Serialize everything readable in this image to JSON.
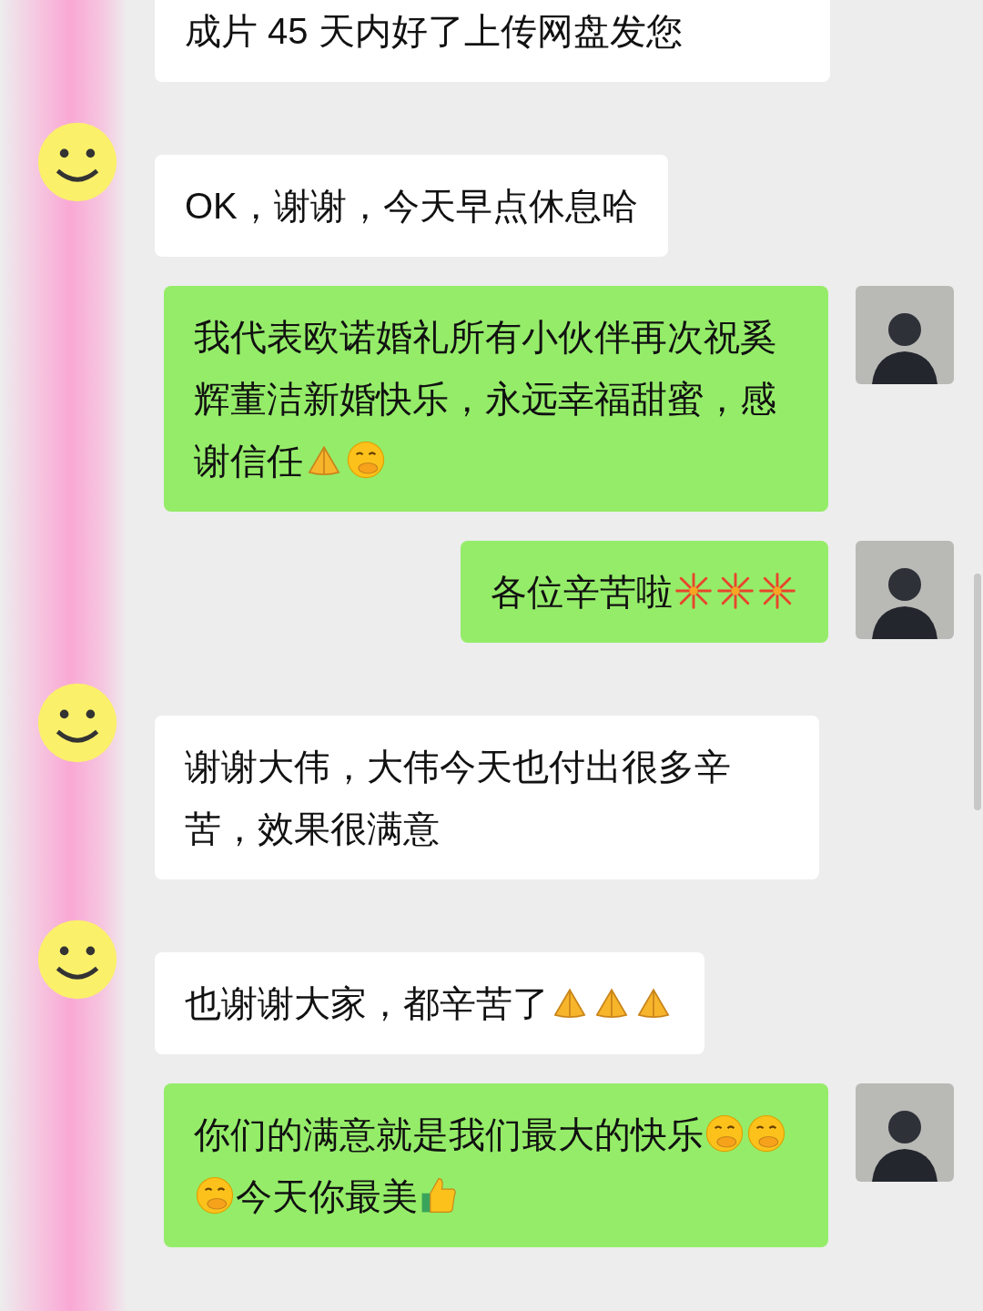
{
  "messages": [
    {
      "kind": "received",
      "parts": [
        {
          "kind": "text",
          "text": "成片 45 天内好了上传网盘发您"
        }
      ]
    },
    {
      "kind": "received",
      "parts": [
        {
          "kind": "text",
          "text": "OK，谢谢，今天早点休息哈"
        }
      ]
    },
    {
      "kind": "sent",
      "parts": [
        {
          "kind": "text",
          "text": "我代表欧诺婚礼所有小伙伴再次祝奚辉董洁新婚快乐，永远幸福甜蜜，感谢信任"
        },
        {
          "kind": "pray"
        },
        {
          "kind": "smirk"
        }
      ]
    },
    {
      "kind": "sent",
      "parts": [
        {
          "kind": "text",
          "text": "各位辛苦啦"
        },
        {
          "kind": "fireworks"
        },
        {
          "kind": "fireworks"
        },
        {
          "kind": "fireworks"
        }
      ]
    },
    {
      "kind": "received",
      "parts": [
        {
          "kind": "text",
          "text": "谢谢大伟，大伟今天也付出很多辛苦，效果很满意"
        }
      ]
    },
    {
      "kind": "received",
      "parts": [
        {
          "kind": "text",
          "text": "也谢谢大家，都辛苦了"
        },
        {
          "kind": "pray"
        },
        {
          "kind": "pray"
        },
        {
          "kind": "pray"
        }
      ]
    },
    {
      "kind": "sent",
      "parts": [
        {
          "kind": "text",
          "text": "你们的满意就是我们最大的快乐"
        },
        {
          "kind": "smirk"
        },
        {
          "kind": "smirk"
        },
        {
          "kind": "smirk"
        },
        {
          "kind": "text",
          "text": "今天你最美"
        },
        {
          "kind": "thumbs_up"
        }
      ]
    }
  ]
}
